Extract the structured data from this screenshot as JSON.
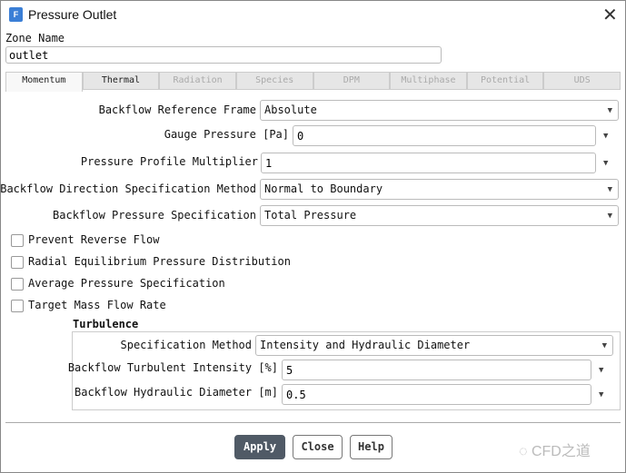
{
  "window": {
    "title": "Pressure Outlet",
    "app_icon": "F",
    "close": "✕"
  },
  "zone": {
    "label": "Zone Name",
    "value": "outlet"
  },
  "tabs": [
    "Momentum",
    "Thermal",
    "Radiation",
    "Species",
    "DPM",
    "Multiphase",
    "Potential",
    "UDS"
  ],
  "fields": {
    "backflow_ref_frame": {
      "label": "Backflow Reference Frame",
      "value": "Absolute"
    },
    "gauge_pressure": {
      "label": "Gauge Pressure [Pa]",
      "value": "0"
    },
    "profile_multiplier": {
      "label": "Pressure Profile Multiplier",
      "value": "1"
    },
    "direction_method": {
      "label": "Backflow Direction Specification Method",
      "value": "Normal to Boundary"
    },
    "pressure_spec": {
      "label": "Backflow Pressure Specification",
      "value": "Total Pressure"
    }
  },
  "checkboxes": [
    {
      "label": "Prevent Reverse Flow",
      "checked": false
    },
    {
      "label": "Radial Equilibrium Pressure Distribution",
      "checked": false
    },
    {
      "label": "Average Pressure Specification",
      "checked": false
    },
    {
      "label": "Target Mass Flow Rate",
      "checked": false
    }
  ],
  "turbulence": {
    "heading": "Turbulence",
    "spec_method": {
      "label": "Specification Method",
      "value": "Intensity and Hydraulic Diameter"
    },
    "intensity": {
      "label": "Backflow Turbulent Intensity [%]",
      "value": "5"
    },
    "diameter": {
      "label": "Backflow Hydraulic Diameter [m]",
      "value": "0.5"
    }
  },
  "buttons": {
    "apply": "Apply",
    "close": "Close",
    "help": "Help"
  },
  "watermark": "CFD之道",
  "colors": {
    "apply_bg": "#505a66",
    "accent": "#3b7fd6"
  }
}
